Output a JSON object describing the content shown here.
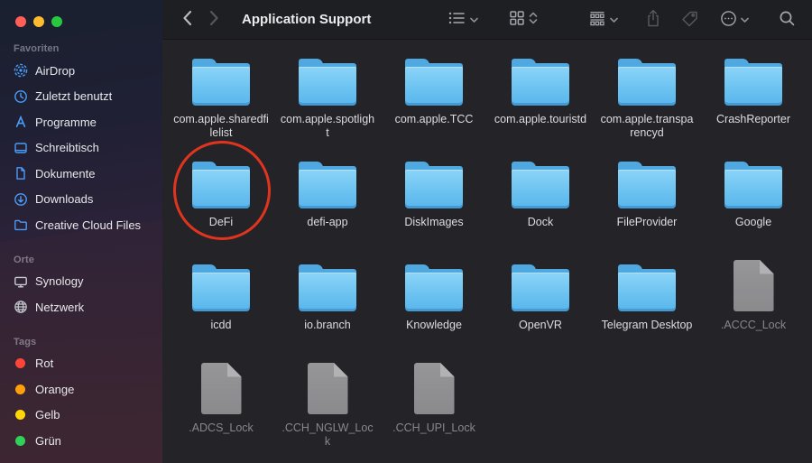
{
  "window": {
    "title": "Application Support"
  },
  "traffic_lights": {
    "red": "#ff5f57",
    "yellow": "#febc2e",
    "green": "#28c840"
  },
  "sidebar": {
    "sections": [
      {
        "title": "Favoriten",
        "items": [
          {
            "label": "AirDrop",
            "icon": "airdrop-icon"
          },
          {
            "label": "Zuletzt benutzt",
            "icon": "clock-icon"
          },
          {
            "label": "Programme",
            "icon": "applications-icon"
          },
          {
            "label": "Schreibtisch",
            "icon": "desktop-icon"
          },
          {
            "label": "Dokumente",
            "icon": "document-icon"
          },
          {
            "label": "Downloads",
            "icon": "download-icon"
          },
          {
            "label": "Creative Cloud Files",
            "icon": "folder-outline-icon"
          }
        ]
      },
      {
        "title": "Orte",
        "items": [
          {
            "label": "Synology",
            "icon": "display-icon"
          },
          {
            "label": "Netzwerk",
            "icon": "globe-icon"
          }
        ]
      },
      {
        "title": "Tags",
        "items": [
          {
            "label": "Rot",
            "color": "#ff453a"
          },
          {
            "label": "Orange",
            "color": "#ff9f0a"
          },
          {
            "label": "Gelb",
            "color": "#ffd60a"
          },
          {
            "label": "Grün",
            "color": "#30d158"
          }
        ]
      }
    ]
  },
  "toolbar": {
    "title": "Application Support",
    "icons": [
      "chevron-left-icon",
      "chevron-right-icon",
      "list-view-icon",
      "icon-view-icon",
      "group-view-icon",
      "share-icon",
      "tag-icon",
      "more-icon",
      "search-icon"
    ]
  },
  "grid": {
    "items": [
      {
        "name": "com.apple.sharedfilelist",
        "type": "folder",
        "hidden": false
      },
      {
        "name": "com.apple.spotlight",
        "type": "folder",
        "hidden": false
      },
      {
        "name": "com.apple.TCC",
        "type": "folder",
        "hidden": false
      },
      {
        "name": "com.apple.touristd",
        "type": "folder",
        "hidden": false
      },
      {
        "name": "com.apple.transparencyd",
        "type": "folder",
        "hidden": false
      },
      {
        "name": "CrashReporter",
        "type": "folder",
        "hidden": false
      },
      {
        "name": "DeFi",
        "type": "folder",
        "hidden": false,
        "annotated": true
      },
      {
        "name": "defi-app",
        "type": "folder",
        "hidden": false
      },
      {
        "name": "DiskImages",
        "type": "folder",
        "hidden": false
      },
      {
        "name": "Dock",
        "type": "folder",
        "hidden": false
      },
      {
        "name": "FileProvider",
        "type": "folder",
        "hidden": false
      },
      {
        "name": "Google",
        "type": "folder",
        "hidden": false
      },
      {
        "name": "icdd",
        "type": "folder",
        "hidden": false
      },
      {
        "name": "io.branch",
        "type": "folder",
        "hidden": false
      },
      {
        "name": "Knowledge",
        "type": "folder",
        "hidden": false
      },
      {
        "name": "OpenVR",
        "type": "folder",
        "hidden": false
      },
      {
        "name": "Telegram Desktop",
        "type": "folder",
        "hidden": false
      },
      {
        "name": ".ACCC_Lock",
        "type": "file",
        "hidden": true
      },
      {
        "name": ".ADCS_Lock",
        "type": "file",
        "hidden": true
      },
      {
        "name": ".CCH_NGLW_Lock",
        "type": "file",
        "hidden": true
      },
      {
        "name": ".CCH_UPI_Lock",
        "type": "file",
        "hidden": true
      }
    ]
  },
  "annotation": {
    "shape": "ellipse",
    "target": "DeFi",
    "color": "#e1341e"
  },
  "colors": {
    "folder_blue": "#6cc3f1",
    "sidebar_icon_blue": "#4b9cf8",
    "toolbar_bg": "#1e1f22",
    "content_bg": "#242428"
  }
}
